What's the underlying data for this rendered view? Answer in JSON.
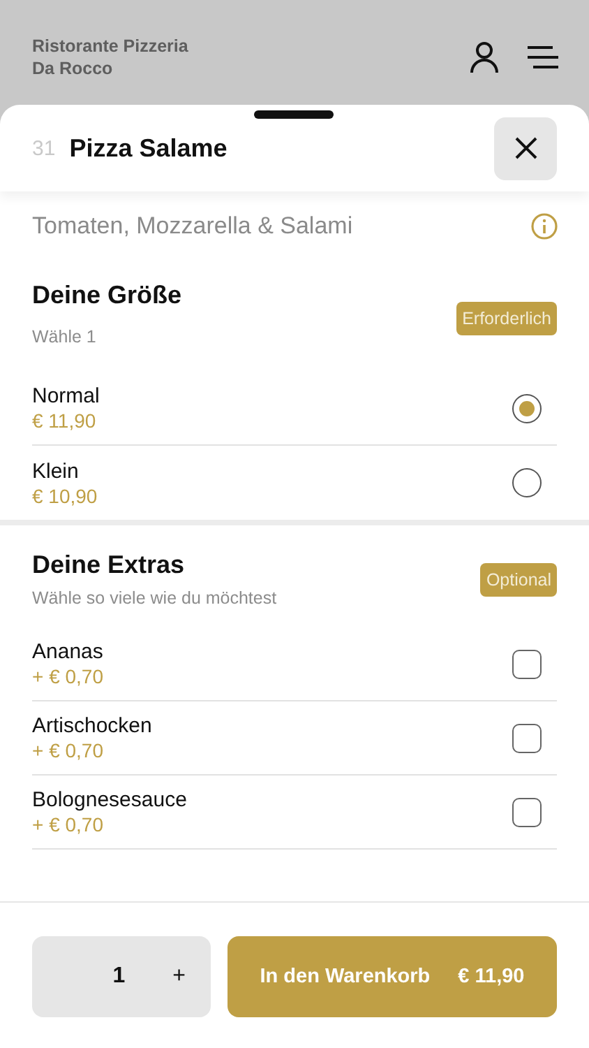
{
  "header": {
    "restaurant_name": "Ristorante Pizzeria",
    "restaurant_subname": "Da Rocco"
  },
  "sheet": {
    "number": "31",
    "title": "Pizza Salame",
    "description": "Tomaten, Mozzarella & Salami"
  },
  "groups": [
    {
      "kind": "radio",
      "title": "Deine Größe",
      "subtitle": "Wähle 1",
      "badge": "Erforderlich",
      "options": [
        {
          "name": "Normal",
          "price": "€ 11,90",
          "selected": true
        },
        {
          "name": "Klein",
          "price": "€ 10,90",
          "selected": false
        }
      ]
    },
    {
      "kind": "checkbox",
      "title": "Deine Extras",
      "subtitle": "Wähle so viele wie du möchtest",
      "badge": "Optional",
      "options": [
        {
          "name": "Ananas",
          "price": "+ € 0,70",
          "checked": false
        },
        {
          "name": "Artischocken",
          "price": "+ € 0,70",
          "checked": false
        },
        {
          "name": "Bolognesesauce",
          "price": "+ € 0,70",
          "checked": false
        }
      ]
    }
  ],
  "footer": {
    "quantity": "1",
    "increment": "+",
    "cart_label": "In den Warenkorb",
    "cart_price": "€ 11,90"
  }
}
